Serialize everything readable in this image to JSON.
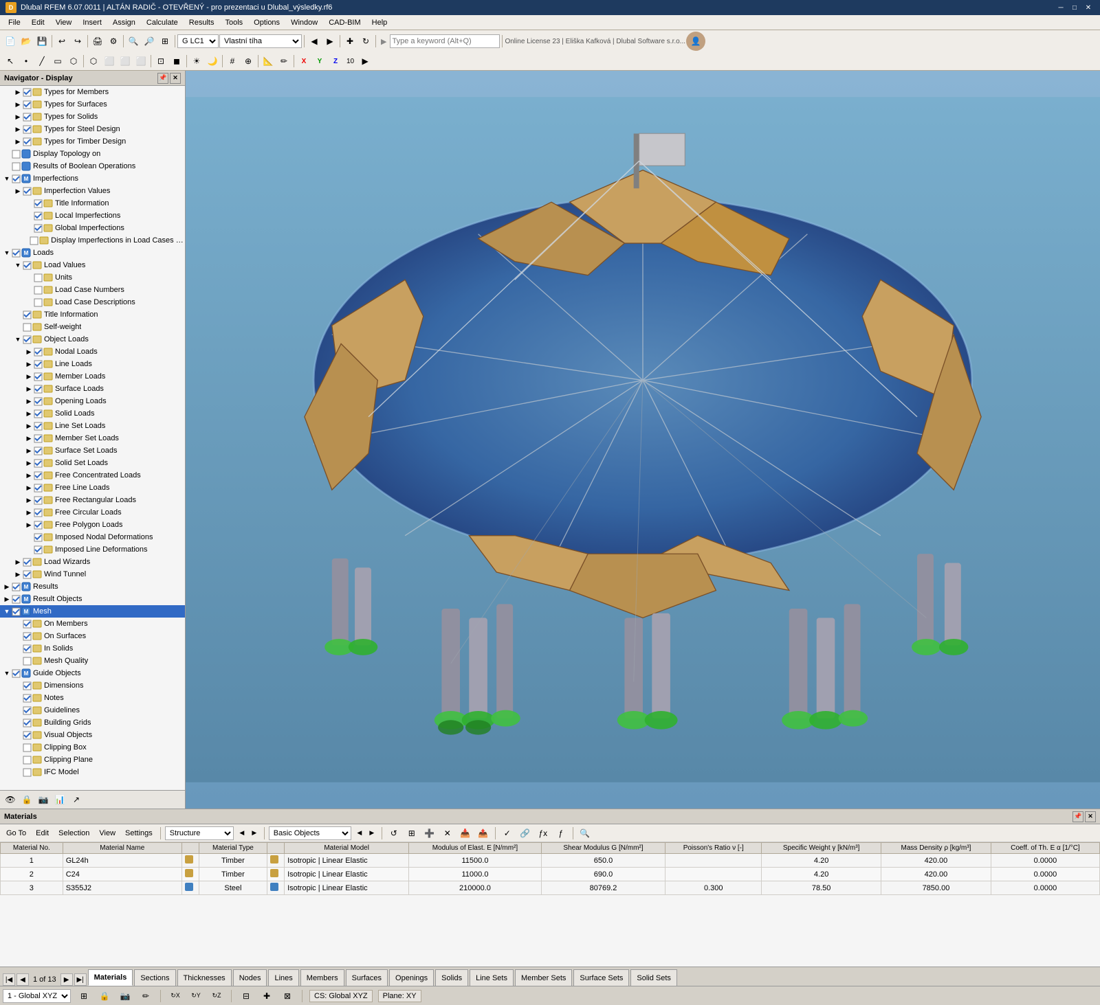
{
  "titlebar": {
    "title": "Dlubal RFEM 6.07.0011 | ALTÁN RADIČ - OTEVŘENÝ - pro prezentaci u Dlubal_výsledky.rf6",
    "logo": "D",
    "btns": [
      "─",
      "□",
      "✕"
    ]
  },
  "menubar": {
    "items": [
      "File",
      "Edit",
      "View",
      "Insert",
      "Assign",
      "Calculate",
      "Results",
      "Tools",
      "Options",
      "Window",
      "CAD-BIM",
      "Help"
    ]
  },
  "toolbar1": {
    "search_placeholder": "Type a keyword (Alt+Q)",
    "license_info": "Online License 23 | Eliška Kafková | Dlubal Software s.r.o...",
    "lc_label": "G LC1",
    "vlastni_label": "Vlastní tíha"
  },
  "navigator": {
    "title": "Navigator - Display",
    "tree": [
      {
        "id": "types-members",
        "indent": 1,
        "arrow": "▶",
        "checked": true,
        "icon": "🔷",
        "label": "Types for Members",
        "level": 1
      },
      {
        "id": "types-surfaces",
        "indent": 1,
        "arrow": "▶",
        "checked": true,
        "icon": "🔷",
        "label": "Types for Surfaces",
        "level": 1
      },
      {
        "id": "types-solids",
        "indent": 1,
        "arrow": "▶",
        "checked": true,
        "icon": "🔷",
        "label": "Types for Solids",
        "level": 1
      },
      {
        "id": "types-steel",
        "indent": 1,
        "arrow": "▶",
        "checked": true,
        "icon": "🔷",
        "label": "Types for Steel Design",
        "level": 1
      },
      {
        "id": "types-timber",
        "indent": 1,
        "arrow": "▶",
        "checked": true,
        "icon": "🔷",
        "label": "Types for Timber Design",
        "level": 1
      },
      {
        "id": "display-topology",
        "indent": 0,
        "arrow": " ",
        "checked": false,
        "icon": "🔲",
        "label": "Display Topology on",
        "level": 0
      },
      {
        "id": "boolean-results",
        "indent": 0,
        "arrow": " ",
        "checked": false,
        "icon": "🔲",
        "label": "Results of Boolean Operations",
        "level": 0
      },
      {
        "id": "imperfections",
        "indent": 0,
        "arrow": "▼",
        "checked": true,
        "icon": "🔷",
        "label": "Imperfections",
        "level": 0
      },
      {
        "id": "imperfection-values",
        "indent": 1,
        "arrow": "▶",
        "checked": true,
        "icon": "📋",
        "label": "Imperfection Values",
        "level": 1
      },
      {
        "id": "title-info-imp",
        "indent": 2,
        "arrow": " ",
        "checked": true,
        "icon": "📄",
        "label": "Title Information",
        "level": 2
      },
      {
        "id": "local-imperfections",
        "indent": 2,
        "arrow": " ",
        "checked": true,
        "icon": "📄",
        "label": "Local Imperfections",
        "level": 2
      },
      {
        "id": "global-imperfections",
        "indent": 2,
        "arrow": " ",
        "checked": true,
        "icon": "📄",
        "label": "Global Imperfections",
        "level": 2
      },
      {
        "id": "display-imperfections",
        "indent": 2,
        "arrow": " ",
        "checked": false,
        "icon": "📄",
        "label": "Display Imperfections in Load Cases & Combi...",
        "level": 2
      },
      {
        "id": "loads",
        "indent": 0,
        "arrow": "▼",
        "checked": true,
        "icon": "🔷",
        "label": "Loads",
        "level": 0
      },
      {
        "id": "load-values",
        "indent": 1,
        "arrow": "▼",
        "checked": true,
        "icon": "📋",
        "label": "Load Values",
        "level": 1
      },
      {
        "id": "units",
        "indent": 2,
        "arrow": " ",
        "checked": false,
        "icon": "📄",
        "label": "Units",
        "level": 2
      },
      {
        "id": "lc-numbers",
        "indent": 2,
        "arrow": " ",
        "checked": false,
        "icon": "📄",
        "label": "Load Case Numbers",
        "level": 2
      },
      {
        "id": "lc-descriptions",
        "indent": 2,
        "arrow": " ",
        "checked": false,
        "icon": "📄",
        "label": "Load Case Descriptions",
        "level": 2
      },
      {
        "id": "title-info-loads",
        "indent": 1,
        "arrow": " ",
        "checked": true,
        "icon": "📄",
        "label": "Title Information",
        "level": 1
      },
      {
        "id": "self-weight",
        "indent": 1,
        "arrow": " ",
        "checked": false,
        "icon": "📄",
        "label": "Self-weight",
        "level": 1
      },
      {
        "id": "object-loads",
        "indent": 1,
        "arrow": "▼",
        "checked": true,
        "icon": "📋",
        "label": "Object Loads",
        "level": 1
      },
      {
        "id": "nodal-loads",
        "indent": 2,
        "arrow": "▶",
        "checked": true,
        "icon": "📄",
        "label": "Nodal Loads",
        "level": 2
      },
      {
        "id": "line-loads",
        "indent": 2,
        "arrow": "▶",
        "checked": true,
        "icon": "📄",
        "label": "Line Loads",
        "level": 2
      },
      {
        "id": "member-loads",
        "indent": 2,
        "arrow": "▶",
        "checked": true,
        "icon": "📄",
        "label": "Member Loads",
        "level": 2
      },
      {
        "id": "surface-loads",
        "indent": 2,
        "arrow": "▶",
        "checked": true,
        "icon": "📄",
        "label": "Surface Loads",
        "level": 2
      },
      {
        "id": "opening-loads",
        "indent": 2,
        "arrow": "▶",
        "checked": true,
        "icon": "📄",
        "label": "Opening Loads",
        "level": 2
      },
      {
        "id": "solid-loads",
        "indent": 2,
        "arrow": "▶",
        "checked": true,
        "icon": "📄",
        "label": "Solid Loads",
        "level": 2
      },
      {
        "id": "line-set-loads",
        "indent": 2,
        "arrow": "▶",
        "checked": true,
        "icon": "📄",
        "label": "Line Set Loads",
        "level": 2
      },
      {
        "id": "member-set-loads",
        "indent": 2,
        "arrow": "▶",
        "checked": true,
        "icon": "📄",
        "label": "Member Set Loads",
        "level": 2
      },
      {
        "id": "surface-set-loads",
        "indent": 2,
        "arrow": "▶",
        "checked": true,
        "icon": "📄",
        "label": "Surface Set Loads",
        "level": 2
      },
      {
        "id": "solid-set-loads",
        "indent": 2,
        "arrow": "▶",
        "checked": true,
        "icon": "📄",
        "label": "Solid Set Loads",
        "level": 2
      },
      {
        "id": "free-conc-loads",
        "indent": 2,
        "arrow": "▶",
        "checked": true,
        "icon": "📄",
        "label": "Free Concentrated Loads",
        "level": 2
      },
      {
        "id": "free-line-loads",
        "indent": 2,
        "arrow": "▶",
        "checked": true,
        "icon": "📄",
        "label": "Free Line Loads",
        "level": 2
      },
      {
        "id": "free-rect-loads",
        "indent": 2,
        "arrow": "▶",
        "checked": true,
        "icon": "📄",
        "label": "Free Rectangular Loads",
        "level": 2
      },
      {
        "id": "free-circ-loads",
        "indent": 2,
        "arrow": "▶",
        "checked": true,
        "icon": "📄",
        "label": "Free Circular Loads",
        "level": 2
      },
      {
        "id": "free-poly-loads",
        "indent": 2,
        "arrow": "▶",
        "checked": true,
        "icon": "📄",
        "label": "Free Polygon Loads",
        "level": 2
      },
      {
        "id": "imposed-nodal",
        "indent": 2,
        "arrow": " ",
        "checked": true,
        "icon": "📄",
        "label": "Imposed Nodal Deformations",
        "level": 2
      },
      {
        "id": "imposed-line",
        "indent": 2,
        "arrow": " ",
        "checked": true,
        "icon": "📄",
        "label": "Imposed Line Deformations",
        "level": 2
      },
      {
        "id": "load-wizards",
        "indent": 1,
        "arrow": "▶",
        "checked": true,
        "icon": "📋",
        "label": "Load Wizards",
        "level": 1
      },
      {
        "id": "wind-tunnel",
        "indent": 1,
        "arrow": "▶",
        "checked": true,
        "icon": "📋",
        "label": "Wind Tunnel",
        "level": 1
      },
      {
        "id": "results",
        "indent": 0,
        "arrow": "▶",
        "checked": true,
        "icon": "🔷",
        "label": "Results",
        "level": 0
      },
      {
        "id": "result-objects",
        "indent": 0,
        "arrow": "▶",
        "checked": true,
        "icon": "🔷",
        "label": "Result Objects",
        "level": 0
      },
      {
        "id": "mesh",
        "indent": 0,
        "arrow": "▼",
        "checked": true,
        "icon": "🔷",
        "label": "Mesh",
        "level": 0,
        "selected": true
      },
      {
        "id": "on-members",
        "indent": 1,
        "arrow": " ",
        "checked": true,
        "icon": "📄",
        "label": "On Members",
        "level": 1
      },
      {
        "id": "on-surfaces",
        "indent": 1,
        "arrow": " ",
        "checked": true,
        "icon": "📄",
        "label": "On Surfaces",
        "level": 1
      },
      {
        "id": "in-solids",
        "indent": 1,
        "arrow": " ",
        "checked": true,
        "icon": "📄",
        "label": "In Solids",
        "level": 1
      },
      {
        "id": "mesh-quality",
        "indent": 1,
        "arrow": " ",
        "checked": false,
        "icon": "📄",
        "label": "Mesh Quality",
        "level": 1
      },
      {
        "id": "guide-objects",
        "indent": 0,
        "arrow": "▼",
        "checked": true,
        "icon": "🔷",
        "label": "Guide Objects",
        "level": 0
      },
      {
        "id": "dimensions",
        "indent": 1,
        "arrow": " ",
        "checked": true,
        "icon": "📄",
        "label": "Dimensions",
        "level": 1
      },
      {
        "id": "notes",
        "indent": 1,
        "arrow": " ",
        "checked": true,
        "icon": "📄",
        "label": "Notes",
        "level": 1
      },
      {
        "id": "guidelines",
        "indent": 1,
        "arrow": " ",
        "checked": true,
        "icon": "📄",
        "label": "Guidelines",
        "level": 1
      },
      {
        "id": "building-grids",
        "indent": 1,
        "arrow": " ",
        "checked": true,
        "icon": "📄",
        "label": "Building Grids",
        "level": 1
      },
      {
        "id": "visual-objects",
        "indent": 1,
        "arrow": " ",
        "checked": true,
        "icon": "📄",
        "label": "Visual Objects",
        "level": 1
      },
      {
        "id": "clipping-box",
        "indent": 1,
        "arrow": " ",
        "checked": false,
        "icon": "📄",
        "label": "Clipping Box",
        "level": 1
      },
      {
        "id": "clipping-plane",
        "indent": 1,
        "arrow": " ",
        "checked": false,
        "icon": "📄",
        "label": "Clipping Plane",
        "level": 1
      },
      {
        "id": "ifc-model",
        "indent": 1,
        "arrow": " ",
        "checked": false,
        "icon": "📄",
        "label": "IFC Model",
        "level": 1
      }
    ]
  },
  "materials_panel": {
    "title": "Materials",
    "goto_label": "Go To",
    "edit_label": "Edit",
    "selection_label": "Selection",
    "view_label": "View",
    "settings_label": "Settings",
    "structure_combo": "Structure",
    "basic_objects_combo": "Basic Objects",
    "columns": [
      "Material No.",
      "Material Name",
      "",
      "Material Type",
      "",
      "Material Model",
      "Modulus of Elast. E [N/mm²]",
      "Shear Modulus G [N/mm²]",
      "Poisson's Ratio ν [-]",
      "Specific Weight γ [kN/m³]",
      "Mass Density ρ [kg/m³]",
      "Coeff. of Th. E α [1/°C]"
    ],
    "rows": [
      {
        "no": "1",
        "name": "GL24h",
        "color": "#c8a040",
        "type": "Timber",
        "model": "Isotropic | Linear Elastic",
        "E": "11500.0",
        "G": "650.0",
        "nu": "",
        "gamma": "4.20",
        "rho": "420.00",
        "alpha": "0.0000"
      },
      {
        "no": "2",
        "name": "C24",
        "color": "#c8a040",
        "type": "Timber",
        "model": "Isotropic | Linear Elastic",
        "E": "11000.0",
        "G": "690.0",
        "nu": "",
        "gamma": "4.20",
        "rho": "420.00",
        "alpha": "0.0000"
      },
      {
        "no": "3",
        "name": "S355J2",
        "color": "#4080c0",
        "type": "Steel",
        "model": "Isotropic | Linear Elastic",
        "E": "210000.0",
        "G": "80769.2",
        "nu": "0.300",
        "gamma": "78.50",
        "rho": "7850.00",
        "alpha": "0.0000"
      }
    ]
  },
  "tabs": {
    "items": [
      "Materials",
      "Sections",
      "Thicknesses",
      "Nodes",
      "Lines",
      "Members",
      "Surfaces",
      "Openings",
      "Solids",
      "Line Sets",
      "Member Sets",
      "Surface Sets",
      "Solid Sets"
    ],
    "active": "Materials",
    "page_info": "1 of 13"
  },
  "statusbar": {
    "item1": "1 - Global XYZ",
    "cs": "CS: Global XYZ",
    "plane": "Plane: XY"
  }
}
